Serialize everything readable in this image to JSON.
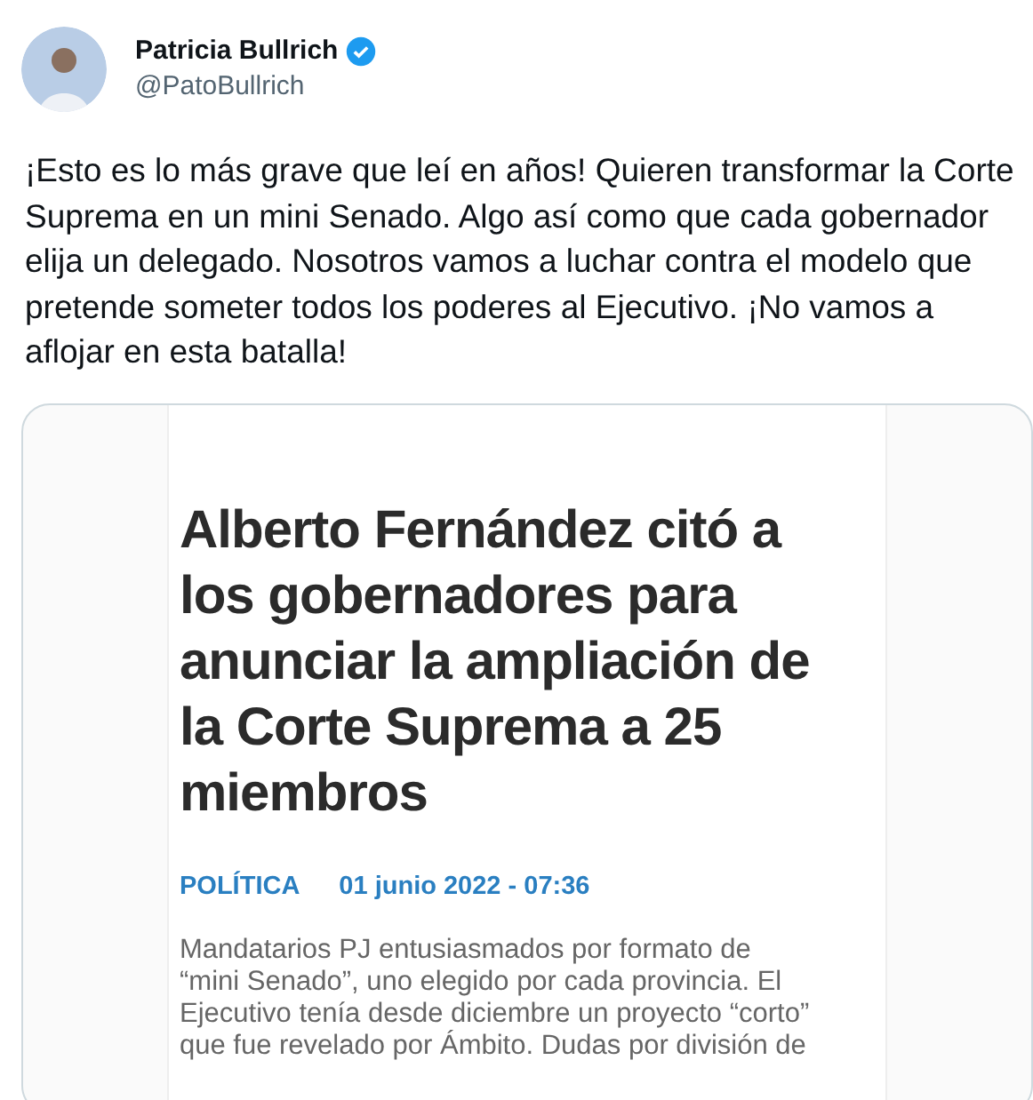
{
  "author": {
    "name": "Patricia Bullrich",
    "handle": "@PatoBullrich",
    "verified": true
  },
  "tweet_text": "¡Esto es lo más grave que leí en años! Quieren transformar la Corte Suprema en un mini Senado. Algo así como que cada gobernador elija un delegado. Nosotros vamos a luchar contra el modelo que pretende someter todos los poderes al Ejecutivo. ¡No vamos a aflojar en esta batalla!",
  "article": {
    "headline_lines": [
      "Alberto Fernández citó a",
      "los gobernadores para",
      "anunciar la ampliación de",
      "la Corte Suprema a 25",
      "miembros"
    ],
    "section": "POLÍTICA",
    "date": "01 junio 2022 - 07:36",
    "body_lines": [
      "Mandatarios PJ entusiasmados por formato de",
      "“mini Senado”, uno elegido por cada provincia. El",
      "Ejecutivo tenía desde diciembre un proyecto “corto”",
      "que fue revelado por Ámbito. Dudas por división de"
    ]
  }
}
